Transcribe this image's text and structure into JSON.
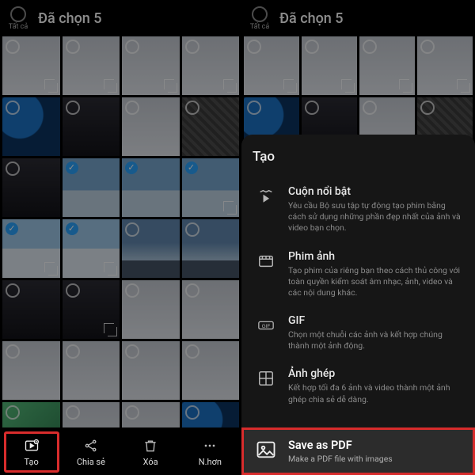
{
  "left": {
    "header": {
      "all_label": "Tất cả",
      "title": "Đã chọn 5"
    },
    "tabs": {
      "create": "Tạo",
      "share": "Chia sẻ",
      "delete": "Xóa",
      "more": "N.hơn"
    }
  },
  "right": {
    "header": {
      "all_label": "Tất cả",
      "title": "Đã chọn 5"
    },
    "sheet": {
      "title": "Tạo",
      "options": [
        {
          "title": "Cuộn nổi bật",
          "sub": "Yêu cầu Bộ sưu tập tự động tạo phim bằng cách sử dụng những phần đẹp nhất của ảnh và video bạn chọn."
        },
        {
          "title": "Phim ảnh",
          "sub": "Tạo phim của riêng bạn theo cách thủ công với toàn quyền kiểm soát âm nhạc, ảnh, video và các nội dung khác."
        },
        {
          "title": "GIF",
          "sub": "Chọn một chuỗi các ảnh và kết hợp chúng thành một ảnh động."
        },
        {
          "title": "Ảnh ghép",
          "sub": "Kết hợp tối đa 6 ảnh và video thành một ảnh ghép chia sẻ dễ dàng."
        }
      ],
      "pdf": {
        "title": "Save as PDF",
        "sub": "Make a PDF file with images"
      }
    }
  }
}
